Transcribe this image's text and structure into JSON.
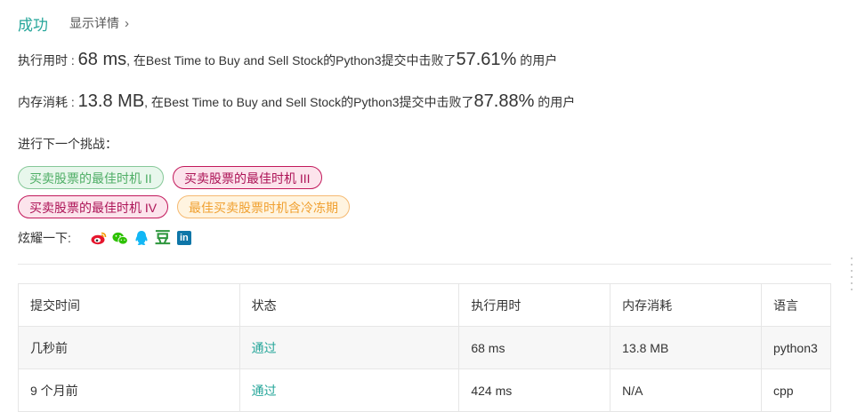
{
  "status": {
    "result": "成功",
    "details_label": "显示详情"
  },
  "runtime": {
    "label": "执行用时 : ",
    "value": "68 ms",
    "mid": ", 在Best Time to Buy and Sell Stock的Python3提交中击败了",
    "percent": "57.61%",
    "suffix": " 的用户"
  },
  "memory": {
    "label": "内存消耗 : ",
    "value": "13.8 MB",
    "mid": ", 在Best Time to Buy and Sell Stock的Python3提交中击败了",
    "percent": "87.88%",
    "suffix": " 的用户"
  },
  "next_challenge": {
    "label": "进行下一个挑战：",
    "tags": [
      "买卖股票的最佳时机 II",
      "买卖股票的最佳时机 III",
      "买卖股票的最佳时机 IV",
      "最佳买卖股票时机含冷冻期"
    ]
  },
  "share": {
    "label": "炫耀一下:",
    "icons": [
      "weibo-icon",
      "wechat-icon",
      "qq-icon",
      "douban-icon",
      "linkedin-icon"
    ],
    "douban_glyph": "豆",
    "linkedin_glyph": "in"
  },
  "table": {
    "headers": [
      "提交时间",
      "状态",
      "执行用时",
      "内存消耗",
      "语言"
    ],
    "rows": [
      [
        "几秒前",
        "通过",
        "68 ms",
        "13.8 MB",
        "python3"
      ],
      [
        "9 个月前",
        "通过",
        "424 ms",
        "N/A",
        "cpp"
      ]
    ]
  },
  "colors": {
    "accent": "#26a69a",
    "tag_green": "#4fae66",
    "tag_red": "#ad1457",
    "tag_orange": "#f0a030"
  }
}
